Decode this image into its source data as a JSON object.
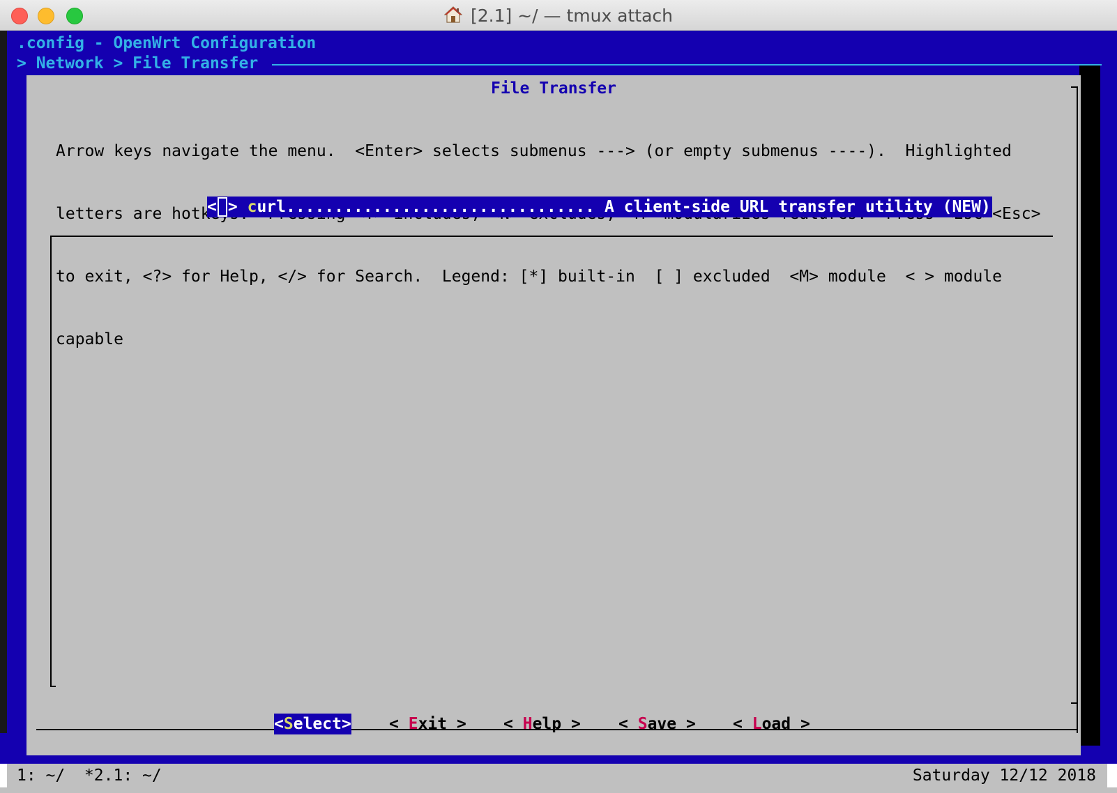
{
  "window": {
    "title": "[2.1]  ~/  — tmux attach",
    "title_icon": "home-icon",
    "traffic_lights": {
      "close": "#fe5f57",
      "minimize": "#febc2e",
      "maximize": "#28c840"
    }
  },
  "terminal": {
    "config_line": ".config - OpenWrt Configuration",
    "breadcrumb": "> Network > File Transfer"
  },
  "dialog": {
    "title": "File Transfer",
    "help_lines": [
      "Arrow keys navigate the menu.  <Enter> selects submenus ---> (or empty submenus ----).  Highlighted",
      "letters are hotkeys.  Pressing <Y> includes, <N> excludes, <M> modularizes features.  Press <Esc><Esc>",
      "to exit, <?> for Help, </> for Search.  Legend: [*] built-in  [ ] excluded  <M> module  < > module",
      "capable"
    ],
    "menu_items": [
      {
        "open_bracket": "<",
        "close_bracket": ">",
        "hotkey_letter": "c",
        "rest_name": "url",
        "dots": "................................",
        "description": "A client-side URL transfer utility (NEW)",
        "selected": true
      }
    ],
    "buttons": [
      {
        "prefix": "<",
        "hotkey": "S",
        "rest": "elect",
        "suffix": ">",
        "active": true
      },
      {
        "prefix": "< ",
        "hotkey": "E",
        "rest": "xit",
        "suffix": " >",
        "active": false
      },
      {
        "prefix": "< ",
        "hotkey": "H",
        "rest": "elp",
        "suffix": " >",
        "active": false
      },
      {
        "prefix": "< ",
        "hotkey": "S",
        "rest": "ave",
        "suffix": " >",
        "active": false
      },
      {
        "prefix": "< ",
        "hotkey": "L",
        "rest": "oad",
        "suffix": " >",
        "active": false
      }
    ]
  },
  "status_bar": {
    "left": "1: ~/  *2.1: ~/",
    "right": "Saturday 12/12 2018"
  },
  "colors": {
    "background": "#1400b0",
    "dialog": "#c0c0c0",
    "accent_text": "#33b1e6",
    "hotkey": "#c6004e",
    "highlight_hotkey": "#d7d76b"
  }
}
